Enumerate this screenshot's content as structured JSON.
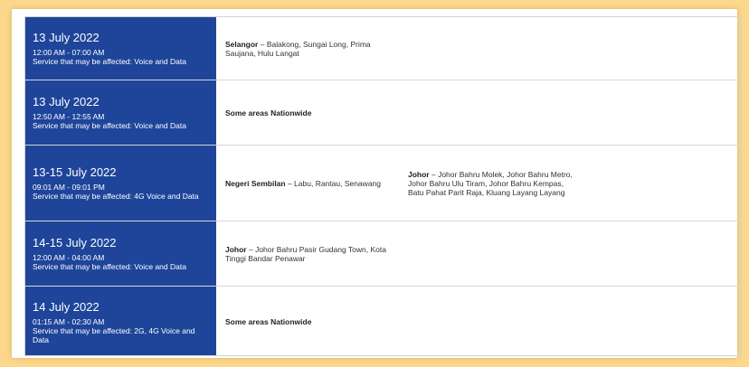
{
  "rows": [
    {
      "date": "13 July 2022",
      "time": "12:00 AM - 07:00 AM",
      "service": "Service that may be affected: Voice and Data",
      "area1": {
        "state": "Selangor",
        "places": " – Balakong, Sungai Long, Prima Saujana, Hulu Langat"
      },
      "area2": {
        "state": "",
        "places": ""
      }
    },
    {
      "date": "13 July 2022",
      "time": "12:50 AM - 12:55 AM",
      "service": "Service that may be affected: Voice and Data",
      "area1": {
        "state": "Some areas Nationwide",
        "places": ""
      },
      "area2": {
        "state": "",
        "places": ""
      }
    },
    {
      "date": "13-15 July 2022",
      "time": "09:01 AM - 09:01 PM",
      "service": "Service that may be affected: 4G Voice and Data",
      "area1": {
        "state": "Negeri Sembilan",
        "places": " – Labu, Rantau, Senawang"
      },
      "area2": {
        "state": "Johor",
        "places": " – Johor Bahru Molek, Johor Bahru Metro, Johor Bahru Ulu Tiram, Johor Bahru Kempas, Batu Pahat Parit Raja, Kluang Layang Layang"
      }
    },
    {
      "date": "14-15 July 2022",
      "time": "12:00 AM - 04:00 AM",
      "service": "Service that may be affected: Voice and Data",
      "area1": {
        "state": "Johor",
        "places": " – Johor Bahru Pasir Gudang Town, Kota Tinggi Bandar Penawar"
      },
      "area2": {
        "state": "",
        "places": ""
      }
    },
    {
      "date": "14 July 2022",
      "time": "01:15 AM - 02:30 AM",
      "service": "Service that may be affected: 2G, 4G Voice and Data",
      "area1": {
        "state": "Some areas Nationwide",
        "places": ""
      },
      "area2": {
        "state": "",
        "places": ""
      }
    }
  ]
}
